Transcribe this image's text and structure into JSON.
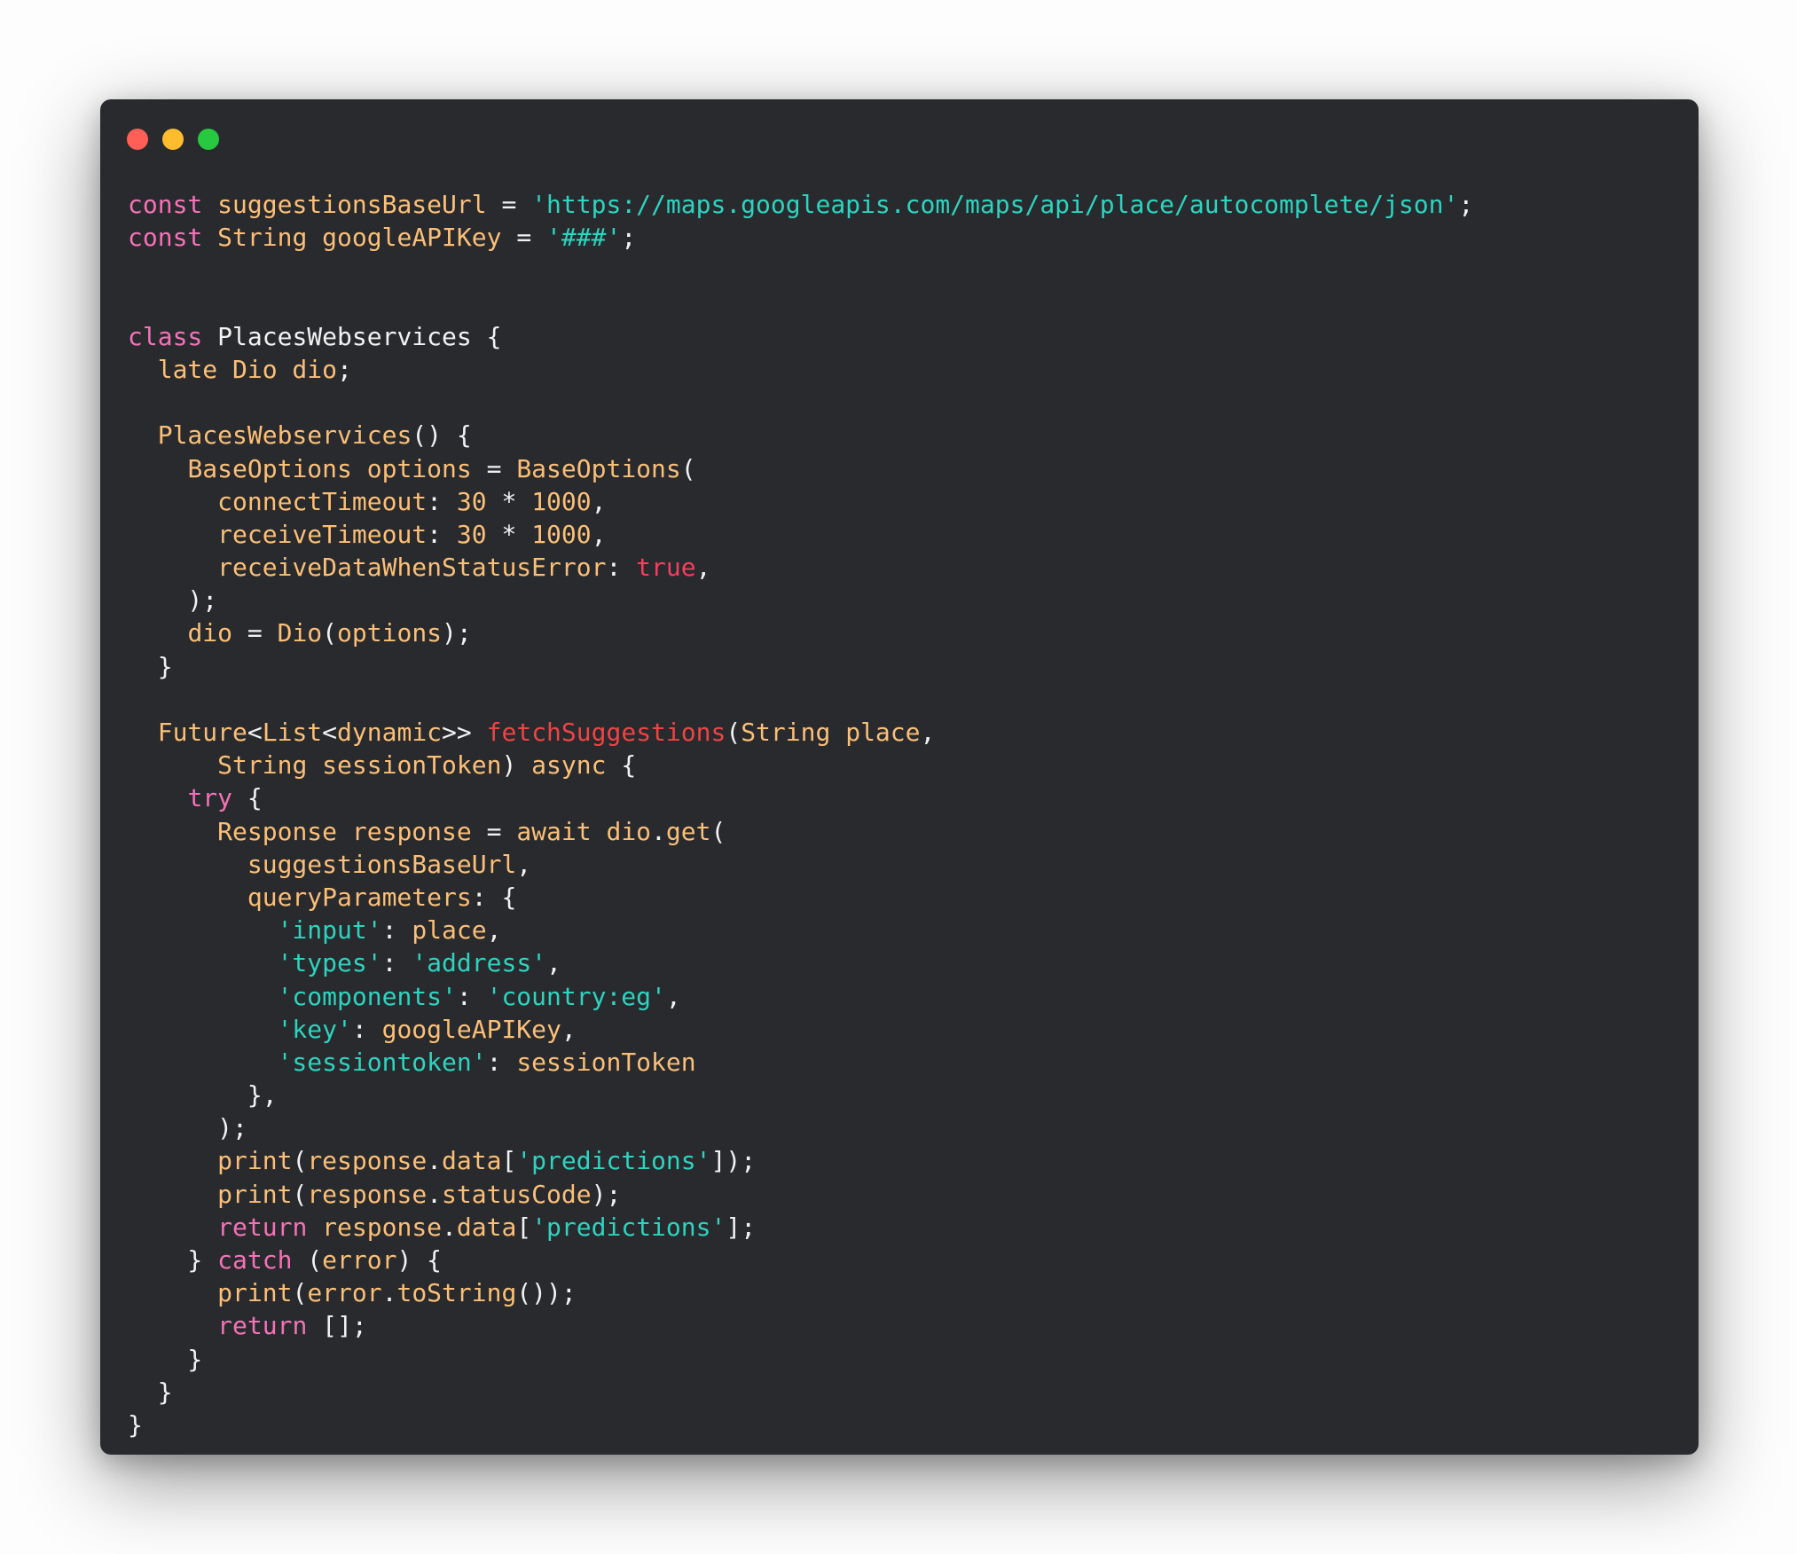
{
  "window_controls": {
    "close_color": "#ff5f56",
    "minimize_color": "#ffbd2e",
    "maximize_color": "#27c93f"
  },
  "syntax_colors": {
    "keyword": "#f472b6",
    "identifier": "#fbbf77",
    "string": "#2dd4bf",
    "number": "#fbbf77",
    "boolean": "#f43f5e",
    "function_def": "#ef4444",
    "plain": "#f2f2f2"
  },
  "code_lines": [
    [
      [
        "k",
        "const"
      ],
      [
        "p",
        " "
      ],
      [
        "i",
        "suggestionsBaseUrl"
      ],
      [
        "p",
        " = "
      ],
      [
        "s",
        "'https://maps.googleapis.com/maps/api/place/autocomplete/json'"
      ],
      [
        "p",
        ";"
      ]
    ],
    [
      [
        "k",
        "const"
      ],
      [
        "p",
        " "
      ],
      [
        "i",
        "String"
      ],
      [
        "p",
        " "
      ],
      [
        "i",
        "googleAPIKey"
      ],
      [
        "p",
        " = "
      ],
      [
        "s",
        "'###'"
      ],
      [
        "p",
        ";"
      ]
    ],
    [],
    [],
    [
      [
        "k",
        "class"
      ],
      [
        "p",
        " PlacesWebservices {"
      ]
    ],
    [
      [
        "p",
        "  "
      ],
      [
        "i",
        "late Dio dio"
      ],
      [
        "p",
        ";"
      ]
    ],
    [],
    [
      [
        "p",
        "  "
      ],
      [
        "i",
        "PlacesWebservices"
      ],
      [
        "p",
        "() {"
      ]
    ],
    [
      [
        "p",
        "    "
      ],
      [
        "i",
        "BaseOptions options"
      ],
      [
        "p",
        " = "
      ],
      [
        "i",
        "BaseOptions"
      ],
      [
        "p",
        "("
      ]
    ],
    [
      [
        "p",
        "      "
      ],
      [
        "i",
        "connectTimeout"
      ],
      [
        "p",
        ": "
      ],
      [
        "n",
        "30"
      ],
      [
        "p",
        " * "
      ],
      [
        "n",
        "1000"
      ],
      [
        "p",
        ","
      ]
    ],
    [
      [
        "p",
        "      "
      ],
      [
        "i",
        "receiveTimeout"
      ],
      [
        "p",
        ": "
      ],
      [
        "n",
        "30"
      ],
      [
        "p",
        " * "
      ],
      [
        "n",
        "1000"
      ],
      [
        "p",
        ","
      ]
    ],
    [
      [
        "p",
        "      "
      ],
      [
        "i",
        "receiveDataWhenStatusError"
      ],
      [
        "p",
        ": "
      ],
      [
        "b",
        "true"
      ],
      [
        "p",
        ","
      ]
    ],
    [
      [
        "p",
        "    );"
      ]
    ],
    [
      [
        "p",
        "    "
      ],
      [
        "i",
        "dio"
      ],
      [
        "p",
        " = "
      ],
      [
        "i",
        "Dio"
      ],
      [
        "p",
        "("
      ],
      [
        "i",
        "options"
      ],
      [
        "p",
        ");"
      ]
    ],
    [
      [
        "p",
        "  }"
      ]
    ],
    [],
    [
      [
        "p",
        "  "
      ],
      [
        "i",
        "Future"
      ],
      [
        "p",
        "<"
      ],
      [
        "i",
        "List"
      ],
      [
        "p",
        "<"
      ],
      [
        "i",
        "dynamic"
      ],
      [
        "p",
        ">> "
      ],
      [
        "f",
        "fetchSuggestions"
      ],
      [
        "p",
        "("
      ],
      [
        "i",
        "String place"
      ],
      [
        "p",
        ","
      ]
    ],
    [
      [
        "p",
        "      "
      ],
      [
        "i",
        "String sessionToken"
      ],
      [
        "p",
        ") "
      ],
      [
        "i",
        "async"
      ],
      [
        "p",
        " {"
      ]
    ],
    [
      [
        "p",
        "    "
      ],
      [
        "k",
        "try"
      ],
      [
        "p",
        " {"
      ]
    ],
    [
      [
        "p",
        "      "
      ],
      [
        "i",
        "Response response"
      ],
      [
        "p",
        " = "
      ],
      [
        "i",
        "await dio"
      ],
      [
        "p",
        "."
      ],
      [
        "i",
        "get"
      ],
      [
        "p",
        "("
      ]
    ],
    [
      [
        "p",
        "        "
      ],
      [
        "i",
        "suggestionsBaseUrl"
      ],
      [
        "p",
        ","
      ]
    ],
    [
      [
        "p",
        "        "
      ],
      [
        "i",
        "queryParameters"
      ],
      [
        "p",
        ": {"
      ]
    ],
    [
      [
        "p",
        "          "
      ],
      [
        "s",
        "'input'"
      ],
      [
        "p",
        ": "
      ],
      [
        "i",
        "place"
      ],
      [
        "p",
        ","
      ]
    ],
    [
      [
        "p",
        "          "
      ],
      [
        "s",
        "'types'"
      ],
      [
        "p",
        ": "
      ],
      [
        "s",
        "'address'"
      ],
      [
        "p",
        ","
      ]
    ],
    [
      [
        "p",
        "          "
      ],
      [
        "s",
        "'components'"
      ],
      [
        "p",
        ": "
      ],
      [
        "s",
        "'country:eg'"
      ],
      [
        "p",
        ","
      ]
    ],
    [
      [
        "p",
        "          "
      ],
      [
        "s",
        "'key'"
      ],
      [
        "p",
        ": "
      ],
      [
        "i",
        "googleAPIKey"
      ],
      [
        "p",
        ","
      ]
    ],
    [
      [
        "p",
        "          "
      ],
      [
        "s",
        "'sessiontoken'"
      ],
      [
        "p",
        ": "
      ],
      [
        "i",
        "sessionToken"
      ]
    ],
    [
      [
        "p",
        "        },"
      ]
    ],
    [
      [
        "p",
        "      );"
      ]
    ],
    [
      [
        "p",
        "      "
      ],
      [
        "i",
        "print"
      ],
      [
        "p",
        "("
      ],
      [
        "i",
        "response"
      ],
      [
        "p",
        "."
      ],
      [
        "i",
        "data"
      ],
      [
        "p",
        "["
      ],
      [
        "s",
        "'predictions'"
      ],
      [
        "p",
        "]);"
      ]
    ],
    [
      [
        "p",
        "      "
      ],
      [
        "i",
        "print"
      ],
      [
        "p",
        "("
      ],
      [
        "i",
        "response"
      ],
      [
        "p",
        "."
      ],
      [
        "i",
        "statusCode"
      ],
      [
        "p",
        ");"
      ]
    ],
    [
      [
        "p",
        "      "
      ],
      [
        "k",
        "return"
      ],
      [
        "p",
        " "
      ],
      [
        "i",
        "response"
      ],
      [
        "p",
        "."
      ],
      [
        "i",
        "data"
      ],
      [
        "p",
        "["
      ],
      [
        "s",
        "'predictions'"
      ],
      [
        "p",
        "];"
      ]
    ],
    [
      [
        "p",
        "    } "
      ],
      [
        "k",
        "catch"
      ],
      [
        "p",
        " ("
      ],
      [
        "i",
        "error"
      ],
      [
        "p",
        ") {"
      ]
    ],
    [
      [
        "p",
        "      "
      ],
      [
        "i",
        "print"
      ],
      [
        "p",
        "("
      ],
      [
        "i",
        "error"
      ],
      [
        "p",
        "."
      ],
      [
        "i",
        "toString"
      ],
      [
        "p",
        "());"
      ]
    ],
    [
      [
        "p",
        "      "
      ],
      [
        "k",
        "return"
      ],
      [
        "p",
        " [];"
      ]
    ],
    [
      [
        "p",
        "    }"
      ]
    ],
    [
      [
        "p",
        "  }"
      ]
    ],
    [
      [
        "p",
        "}"
      ]
    ]
  ]
}
